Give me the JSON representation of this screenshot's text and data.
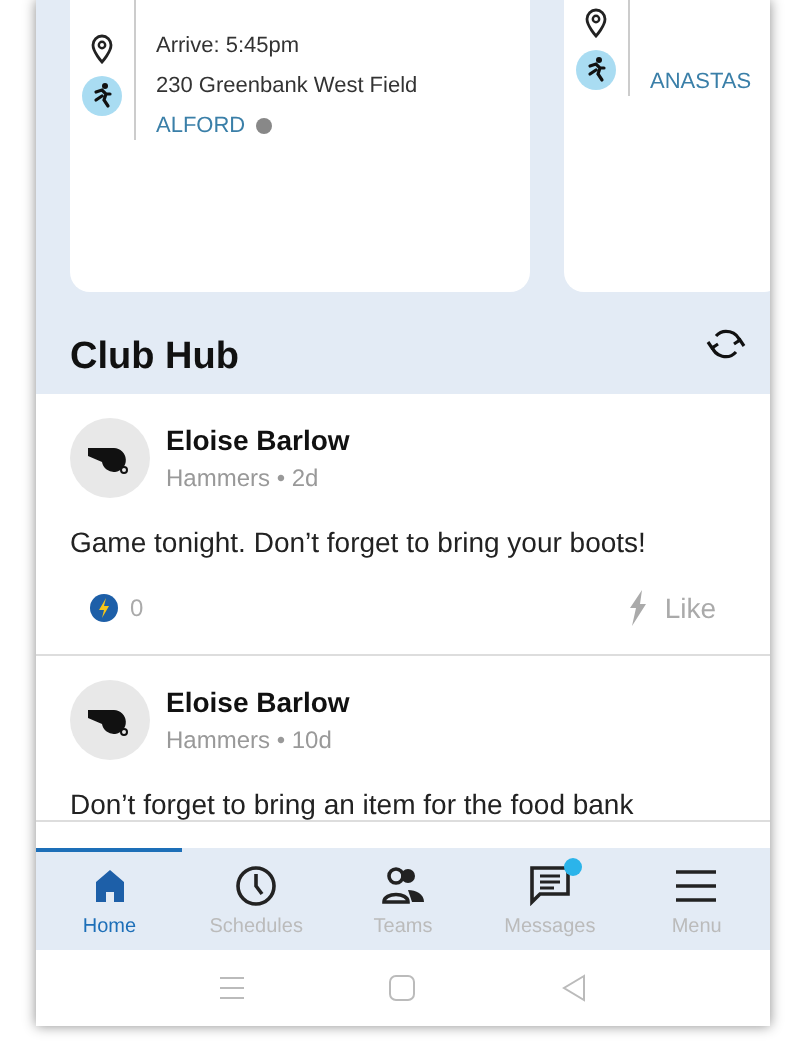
{
  "events": [
    {
      "arrive": "Arrive: 5:45pm",
      "location": "230 Greenbank West Field",
      "team": "ALFORD",
      "status_dot": true
    },
    {
      "team": "ANASTAS",
      "status_dot": false
    }
  ],
  "section": {
    "title": "Club Hub"
  },
  "posts": [
    {
      "author": "Eloise Barlow",
      "meta": "Hammers • 2d",
      "body": "Game tonight. Don’t forget to bring your boots!",
      "count": "0",
      "like": "Like"
    },
    {
      "author": "Eloise Barlow",
      "meta": "Hammers • 10d",
      "body": "Don’t forget to bring an item for the food bank"
    }
  ],
  "nav": [
    {
      "label": "Home",
      "selected": true,
      "badge": false
    },
    {
      "label": "Schedules",
      "selected": false,
      "badge": false
    },
    {
      "label": "Teams",
      "selected": false,
      "badge": false
    },
    {
      "label": "Messages",
      "selected": false,
      "badge": true
    },
    {
      "label": "Menu",
      "selected": false,
      "badge": false
    }
  ]
}
